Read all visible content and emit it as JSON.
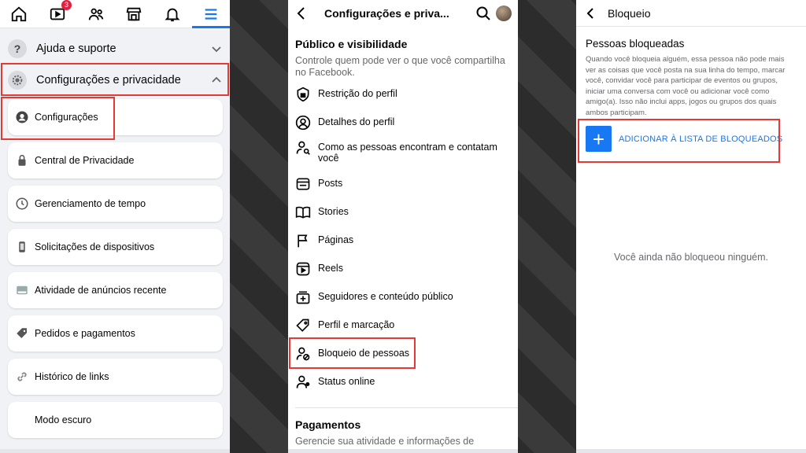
{
  "panel1": {
    "nav": {
      "notifications_badge": "3"
    },
    "sections": [
      {
        "label": "Ajuda e suporte",
        "icon": "question-icon"
      },
      {
        "label": "Configurações e privacidade",
        "icon": "gear-icon"
      }
    ],
    "items": [
      {
        "label": "Configurações",
        "icon": "user-circle-icon"
      },
      {
        "label": "Central de Privacidade",
        "icon": "lock-icon"
      },
      {
        "label": "Gerenciamento de tempo",
        "icon": "clock-icon"
      },
      {
        "label": "Solicitações de dispositivos",
        "icon": "phone-icon"
      },
      {
        "label": "Atividade de anúncios recente",
        "icon": "ad-icon"
      },
      {
        "label": "Pedidos e pagamentos",
        "icon": "tag-icon"
      },
      {
        "label": "Histórico de links",
        "icon": "link-icon"
      },
      {
        "label": "Modo escuro",
        "icon": "moon-icon"
      }
    ]
  },
  "panel2": {
    "header": {
      "title": "Configurações e priva..."
    },
    "section": {
      "title": "Público e visibilidade",
      "description": "Controle quem pode ver o que você compartilha no Facebook."
    },
    "options": [
      {
        "label": "Restrição do perfil",
        "icon": "shield-lock-icon"
      },
      {
        "label": "Detalhes do perfil",
        "icon": "user-circle-icon"
      },
      {
        "label": "Como as pessoas encontram e contatam você",
        "icon": "user-search-icon"
      },
      {
        "label": "Posts",
        "icon": "post-icon"
      },
      {
        "label": "Stories",
        "icon": "book-icon"
      },
      {
        "label": "Páginas",
        "icon": "flag-icon"
      },
      {
        "label": "Reels",
        "icon": "reels-icon"
      },
      {
        "label": "Seguidores e conteúdo público",
        "icon": "followers-icon"
      },
      {
        "label": "Perfil e marcação",
        "icon": "tag-icon"
      },
      {
        "label": "Bloqueio de pessoas",
        "icon": "user-block-icon"
      },
      {
        "label": "Status online",
        "icon": "user-status-icon"
      }
    ],
    "section2": {
      "title": "Pagamentos",
      "description": "Gerencie sua atividade e informações de"
    }
  },
  "panel3": {
    "header": {
      "title": "Bloqueio"
    },
    "subtitle": "Pessoas bloqueadas",
    "description": "Quando você bloqueia alguém, essa pessoa não pode mais ver as coisas que você posta na sua linha do tempo, marcar você, convidar você para participar de eventos ou grupos, iniciar uma conversa com você ou adicionar você como amigo(a). Isso não inclui apps, jogos ou grupos dos quais ambos participam.",
    "add_button": "ADICIONAR À LISTA DE BLOQUEADOS",
    "empty_message": "Você ainda não bloqueou ninguém."
  },
  "colors": {
    "accent": "#1877f2",
    "highlight": "#e53935",
    "badge": "#e41e3f"
  }
}
